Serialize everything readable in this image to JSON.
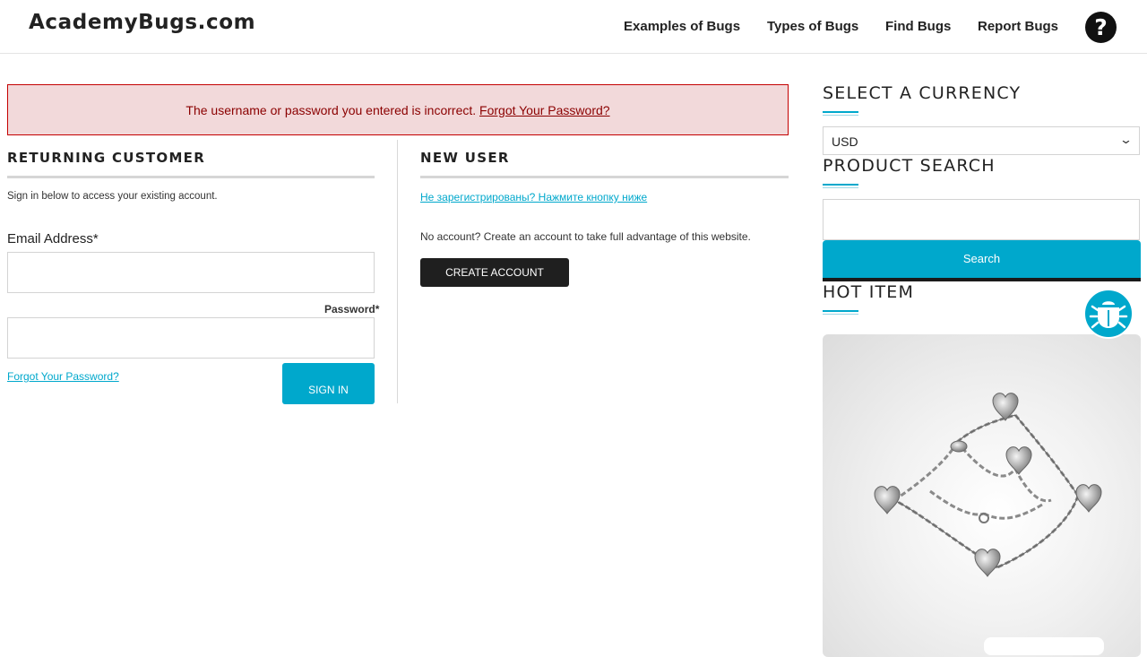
{
  "header": {
    "logo": "AcademyBugs.com",
    "nav": [
      "Examples of Bugs",
      "Types of Bugs",
      "Find Bugs",
      "Report Bugs"
    ],
    "help_icon": "question-circle-icon"
  },
  "alert": {
    "message": "The username or password you entered is incorrect.",
    "link": "Forgot Your Password?"
  },
  "returning_customer": {
    "title": "RETURNING CUSTOMER",
    "intro": "Sign in below to access your existing account.",
    "email_label": "Email Address*",
    "password_label": "Password*",
    "forgot_link": "Forgot Your Password?",
    "signin_button": "SIGN IN"
  },
  "new_user": {
    "title": "NEW USER",
    "register_link": "Не зарегистрированы? Нажмите кнопку ниже",
    "text": "No account? Create an account to take full advantage of this website.",
    "create_button": "CREATE ACCOUNT"
  },
  "sidebar": {
    "currency_title": "SELECT A CURRENCY",
    "currency_value": "USD",
    "search_title": "PRODUCT SEARCH",
    "search_button": "Search",
    "hot_title": "HOT ITEM",
    "bug_report_icon": "bug-icon",
    "product_image": "heart-charm-bracelet"
  },
  "colors": {
    "accent": "#00a8cc",
    "alert_bg": "#f2d9da",
    "alert_border": "#c40000",
    "alert_text": "#8b0000",
    "dark_button": "#1f1f1f"
  }
}
